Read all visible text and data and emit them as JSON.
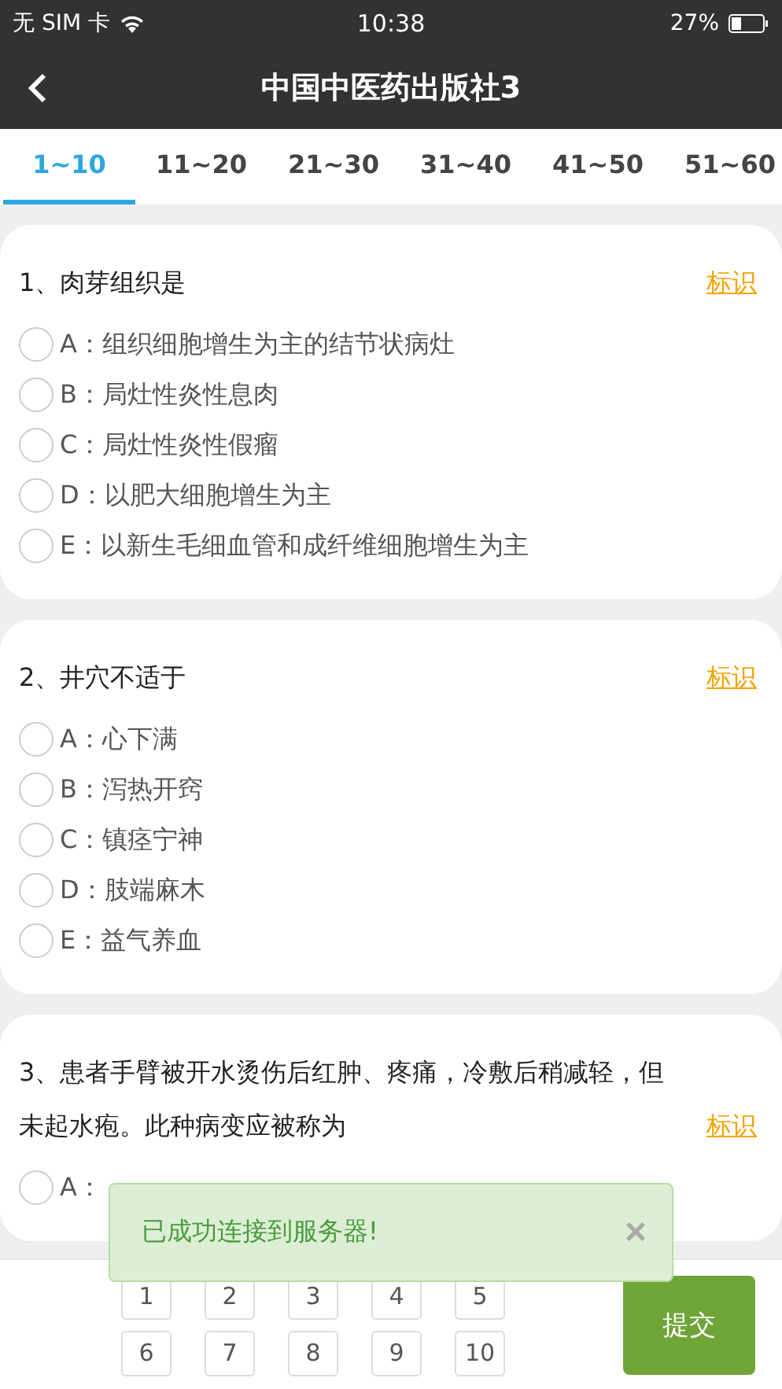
{
  "status_bar": {
    "carrier": "无 SIM 卡",
    "time": "10:38",
    "battery": "27%"
  },
  "nav": {
    "title": "中国中医药出版社3"
  },
  "tabs": [
    {
      "label": "1~10",
      "selected": true
    },
    {
      "label": "11~20",
      "selected": false
    },
    {
      "label": "21~30",
      "selected": false
    },
    {
      "label": "31~40",
      "selected": false
    },
    {
      "label": "41~50",
      "selected": false
    },
    {
      "label": "51~60",
      "selected": false
    }
  ],
  "questions": [
    {
      "text": "1、肉芽组织是",
      "mark": "标识",
      "options": [
        {
          "label": "A：",
          "text": "组织细胞增生为主的结节状病灶",
          "selected": false
        },
        {
          "label": "B：",
          "text": "局灶性炎性息肉",
          "selected": false
        },
        {
          "label": "C：",
          "text": "局灶性炎性假瘤",
          "selected": false
        },
        {
          "label": "D：",
          "text": "以肥大细胞增生为主",
          "selected": false
        },
        {
          "label": "E：",
          "text": "以新生毛细血管和成纤维细胞增生为主",
          "selected": false
        }
      ]
    },
    {
      "text": "2、井穴不适于",
      "mark": "标识",
      "options": [
        {
          "label": "A：",
          "text": "心下满",
          "selected": false
        },
        {
          "label": "B：",
          "text": "泻热开窍",
          "selected": false
        },
        {
          "label": "C：",
          "text": "镇痉宁神",
          "selected": false
        },
        {
          "label": "D：",
          "text": "肢端麻木",
          "selected": false
        },
        {
          "label": "E：",
          "text": "益气养血",
          "selected": false
        }
      ]
    },
    {
      "text": "3、患者手臂被开水烫伤后红肿、疼痛，冷敷后稍减轻，但未起水疱。此种病变应被称为",
      "mark": "标识",
      "options": [
        {
          "label": "A：",
          "selected": false
        }
      ]
    }
  ],
  "toast": {
    "message": "已成功连接到服务器!",
    "close": "×"
  },
  "answer_sheet": {
    "numbers": [
      "1",
      "2",
      "3",
      "4",
      "5",
      "6",
      "7",
      "8",
      "9",
      "10"
    ],
    "submit": "提交"
  }
}
